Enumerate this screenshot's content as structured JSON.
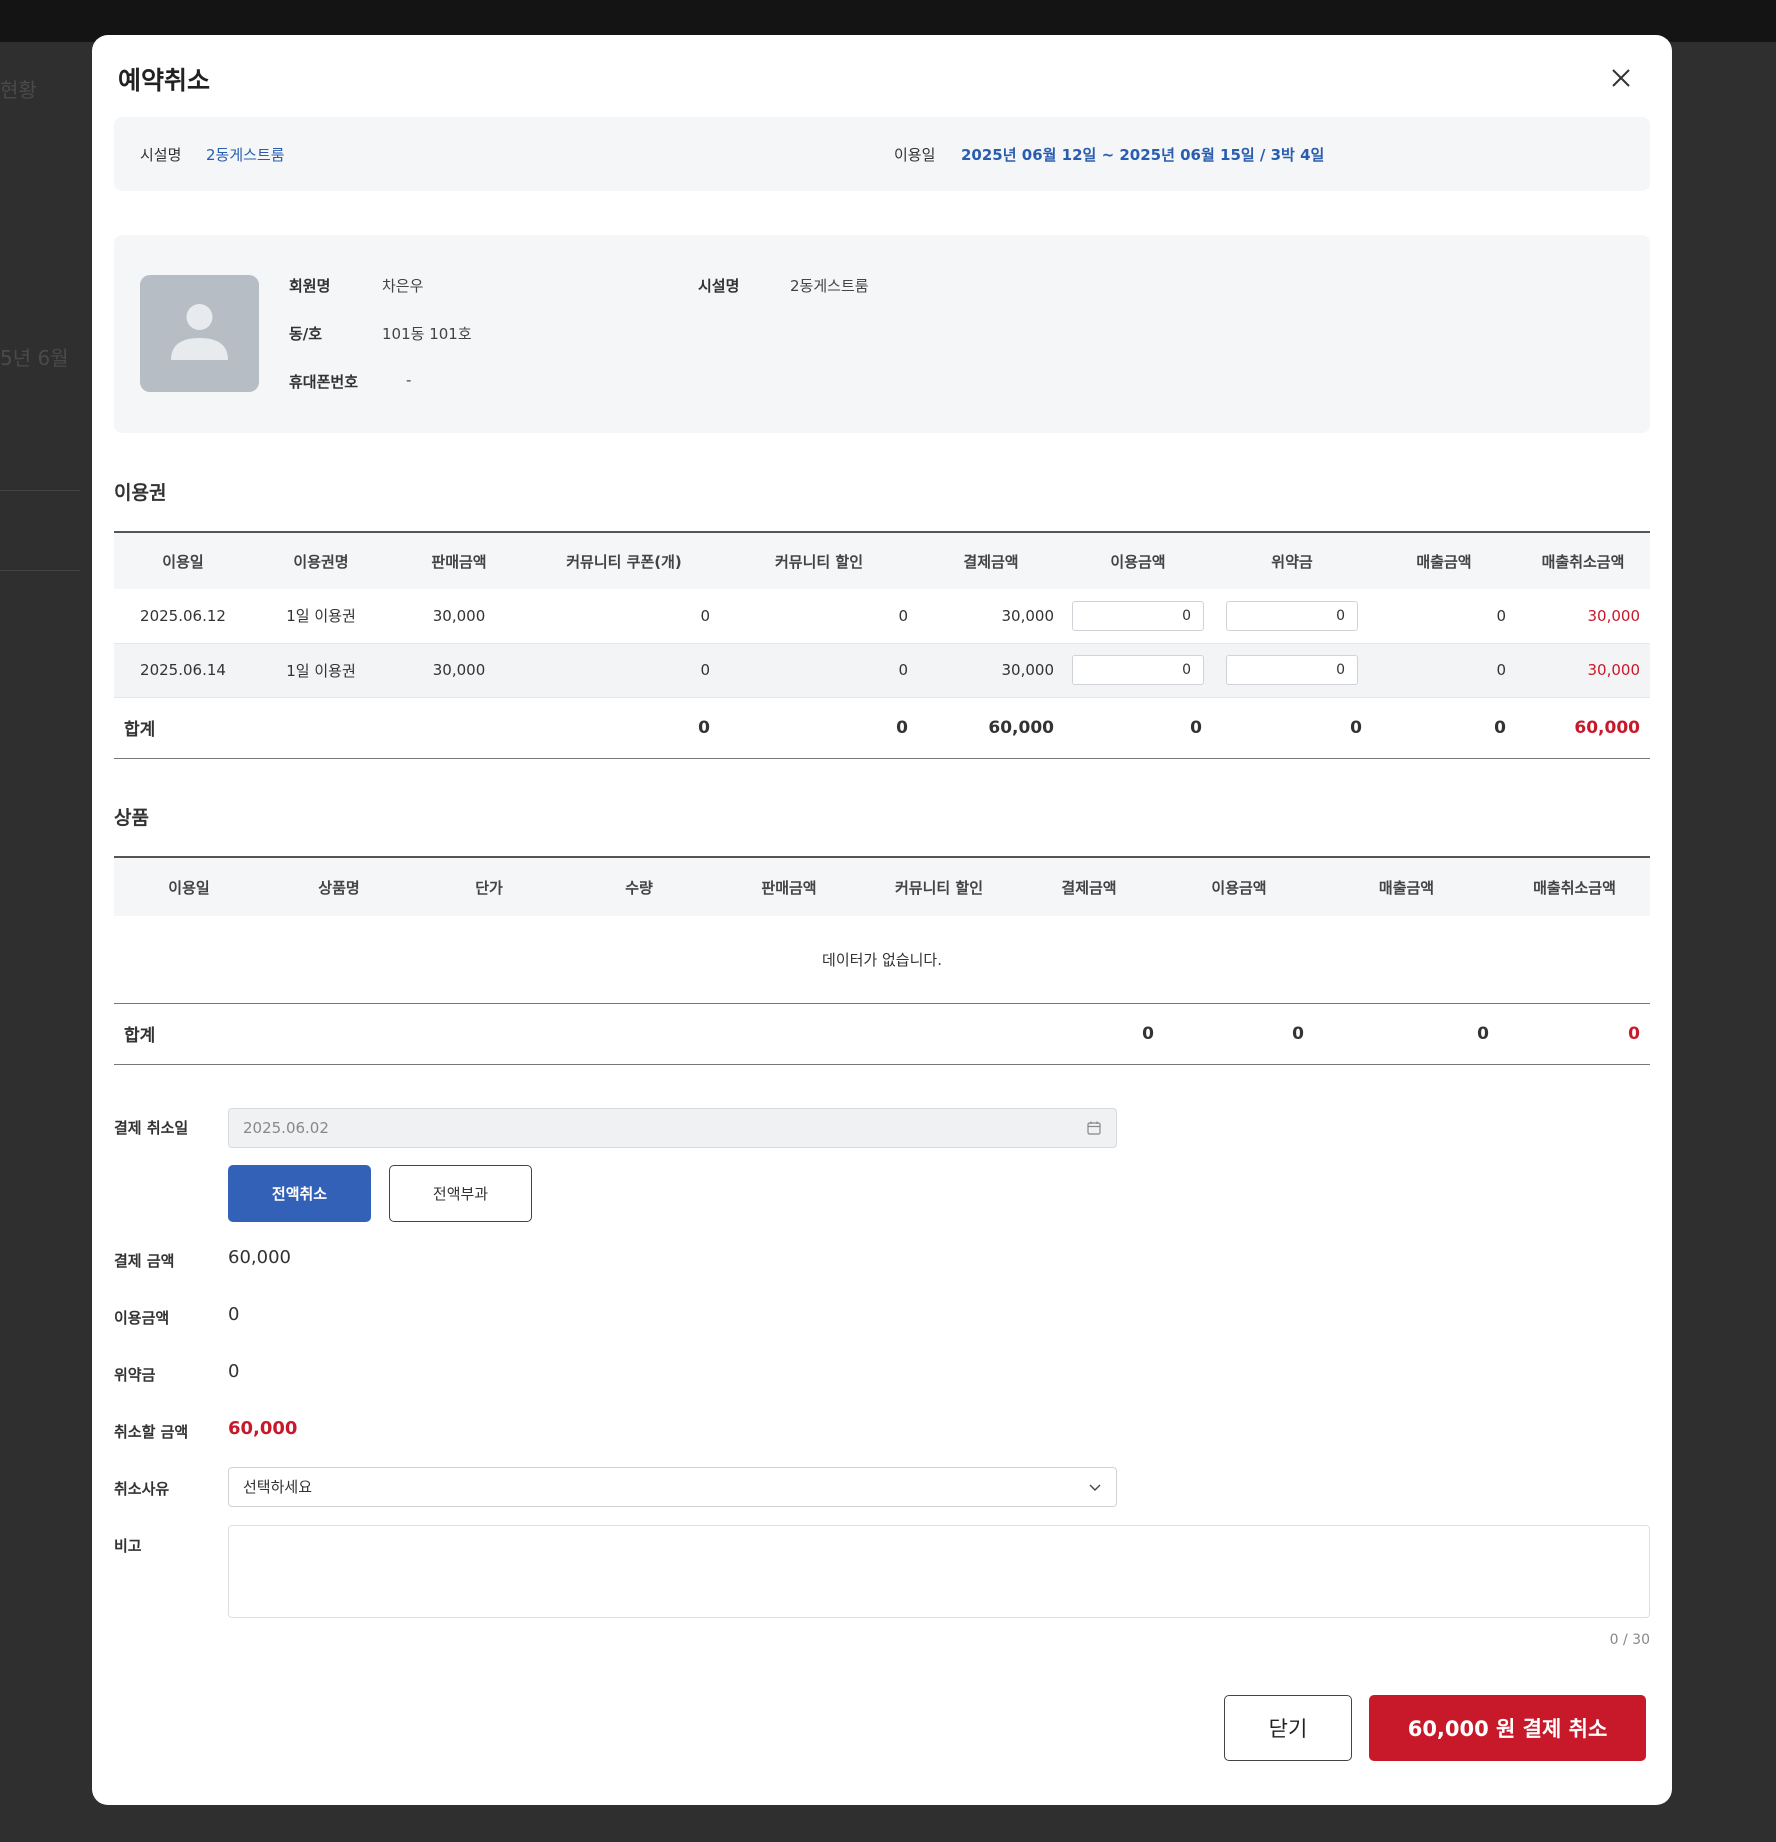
{
  "modal": {
    "title": "예약취소",
    "facility_label": "시설명",
    "facility_value": "2동게스트룸",
    "use_date_label": "이용일",
    "use_date_value": "2025년 06월 12일 ~ 2025년 06월 15일 / 3박 4일"
  },
  "member": {
    "name_label": "회원명",
    "name_value": "차은우",
    "unit_label": "동/호",
    "unit_value": "101동 101호",
    "phone_label": "휴대폰번호",
    "phone_value": "-",
    "facility_label": "시설명",
    "facility_value": "2동게스트룸"
  },
  "tickets": {
    "title": "이용권",
    "headers": [
      "이용일",
      "이용권명",
      "판매금액",
      "커뮤니티 쿠폰(개)",
      "커뮤니티 할인",
      "결제금액",
      "이용금액",
      "위약금",
      "매출금액",
      "매출취소금액"
    ],
    "rows": [
      {
        "date": "2025.06.12",
        "name": "1일 이용권",
        "sale": "30,000",
        "coupon": "0",
        "discount": "0",
        "paid": "30,000",
        "use_amount": "0",
        "penalty": "0",
        "revenue": "0",
        "cancel": "30,000"
      },
      {
        "date": "2025.06.14",
        "name": "1일 이용권",
        "sale": "30,000",
        "coupon": "0",
        "discount": "0",
        "paid": "30,000",
        "use_amount": "0",
        "penalty": "0",
        "revenue": "0",
        "cancel": "30,000"
      }
    ],
    "total": {
      "label": "합계",
      "coupon": "0",
      "discount": "0",
      "paid": "60,000",
      "use_amount": "0",
      "penalty": "0",
      "revenue": "0",
      "cancel": "60,000"
    }
  },
  "products": {
    "title": "상품",
    "headers": [
      "이용일",
      "상품명",
      "단가",
      "수량",
      "판매금액",
      "커뮤니티 할인",
      "결제금액",
      "이용금액",
      "매출금액",
      "매출취소금액"
    ],
    "empty_text": "데이터가 없습니다.",
    "total": {
      "label": "합계",
      "paid": "0",
      "use_amount": "0",
      "revenue": "0",
      "revenue2": "0",
      "cancel": "0"
    }
  },
  "form": {
    "cancel_date_label": "결제 취소일",
    "cancel_date_value": "2025.06.02",
    "full_cancel_label": "전액취소",
    "full_charge_label": "전액부과",
    "pay_amount_label": "결제 금액",
    "pay_amount_value": "60,000",
    "use_amount_label": "이용금액",
    "use_amount_value": "0",
    "penalty_label": "위약금",
    "penalty_value": "0",
    "cancel_amount_label": "취소할 금액",
    "cancel_amount_value": "60,000",
    "reason_label": "취소사유",
    "reason_placeholder": "선택하세요",
    "note_label": "비고",
    "note_counter": "0 / 30"
  },
  "footer": {
    "close_label": "닫기",
    "pay_cancel_label": "60,000 원 결제 취소"
  },
  "colors": {
    "accent_blue": "#3461b8",
    "danger_red": "#c8192a",
    "link_blue": "#2a5db0"
  }
}
